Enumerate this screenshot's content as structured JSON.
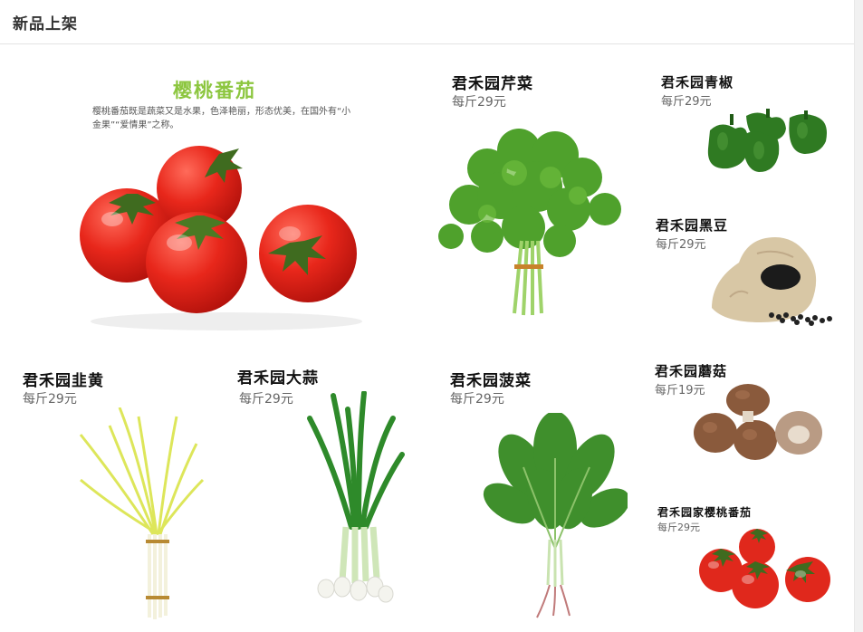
{
  "header": {
    "title": "新品上架"
  },
  "featured": {
    "title": "樱桃番茄",
    "description": "樱桃番茄既是蔬菜又是水果，色泽艳丽，形态优美，在国外有“小金果”“爱情果”之称。"
  },
  "products": [
    {
      "name": "君禾园芹菜",
      "price": "每斤29元",
      "icon": "celery"
    },
    {
      "name": "君禾园青椒",
      "price": "每斤29元",
      "icon": "green-pepper"
    },
    {
      "name": "君禾园黑豆",
      "price": "每斤29元",
      "icon": "black-beans"
    },
    {
      "name": "君禾园韭黄",
      "price": "每斤29元",
      "icon": "yellow-chives"
    },
    {
      "name": "君禾园大蒜",
      "price": "每斤29元",
      "icon": "scallion"
    },
    {
      "name": "君禾园菠菜",
      "price": "每斤29元",
      "icon": "spinach"
    },
    {
      "name": "君禾园蘑菇",
      "price": "每斤19元",
      "icon": "mushroom"
    },
    {
      "name": "君禾园家樱桃番茄",
      "price": "每斤29元",
      "icon": "cherry-tomato"
    }
  ]
}
